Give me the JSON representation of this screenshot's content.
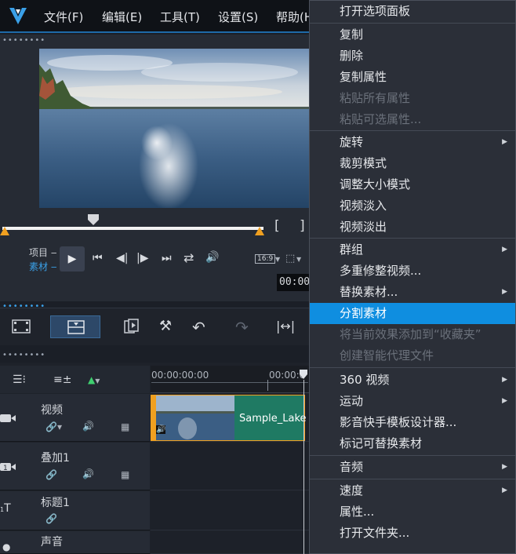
{
  "menubar": {
    "items": [
      "文件(F)",
      "编辑(E)",
      "工具(T)",
      "设置(S)",
      "帮助(H)"
    ]
  },
  "preview": {
    "project_label": "项目",
    "clip_label": "素材",
    "aspect_label": "16:9",
    "timecode": "00:00"
  },
  "timeline": {
    "ruler_times": [
      "00:00:00:00",
      "00:00:0"
    ],
    "tracks": [
      {
        "name": "视频",
        "icon": "video-track-icon"
      },
      {
        "name": "叠加1",
        "icon": "overlay-track-icon",
        "number": "1"
      },
      {
        "name": "标题1",
        "icon": "title-track-icon"
      },
      {
        "name": "声音",
        "icon": "audio-track-icon"
      }
    ],
    "clip_name": "Sample_Lake"
  },
  "context_menu": {
    "items": [
      {
        "label": "打开选项面板",
        "disabled": false
      },
      {
        "label": "复制",
        "disabled": false
      },
      {
        "label": "删除",
        "disabled": false
      },
      {
        "label": "复制属性",
        "disabled": false
      },
      {
        "label": "粘贴所有属性",
        "disabled": true
      },
      {
        "label": "粘贴可选属性...",
        "disabled": true
      },
      {
        "label": "旋转",
        "disabled": false,
        "submenu": true
      },
      {
        "label": "裁剪模式",
        "disabled": false
      },
      {
        "label": "调整大小模式",
        "disabled": false
      },
      {
        "label": "视频淡入",
        "disabled": false
      },
      {
        "label": "视频淡出",
        "disabled": false
      },
      {
        "label": "群组",
        "disabled": false,
        "submenu": true
      },
      {
        "label": "多重修整视频...",
        "disabled": false
      },
      {
        "label": "替换素材...",
        "disabled": false,
        "submenu": true
      },
      {
        "label": "分割素材",
        "disabled": false,
        "selected": true
      },
      {
        "label": "将当前效果添加到“收藏夹”",
        "disabled": true
      },
      {
        "label": "创建智能代理文件",
        "disabled": true
      },
      {
        "label": "360 视频",
        "disabled": false,
        "submenu": true
      },
      {
        "label": "运动",
        "disabled": false,
        "submenu": true
      },
      {
        "label": "影音快手模板设计器...",
        "disabled": false
      },
      {
        "label": "标记可替换素材",
        "disabled": false
      },
      {
        "label": "音频",
        "disabled": false,
        "submenu": true
      },
      {
        "label": "速度",
        "disabled": false,
        "submenu": true
      },
      {
        "label": "属性...",
        "disabled": false
      },
      {
        "label": "打开文件夹...",
        "disabled": false
      }
    ]
  },
  "colors": {
    "accent": "#0f8ee0",
    "clip_green": "#1f7a63",
    "trim_orange": "#f0a020"
  }
}
